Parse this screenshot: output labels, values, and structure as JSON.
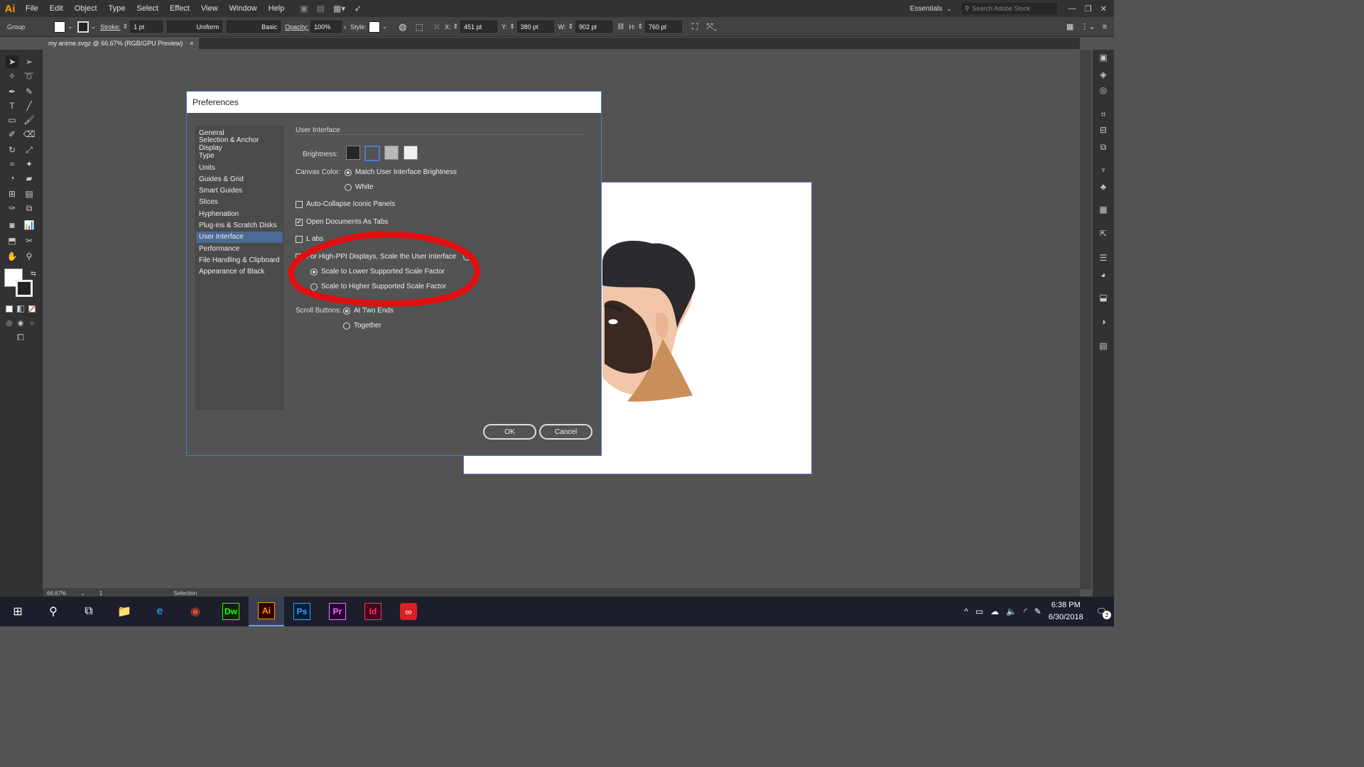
{
  "menubar": {
    "logo": "Ai",
    "items": [
      "File",
      "Edit",
      "Object",
      "Type",
      "Select",
      "Effect",
      "View",
      "Window",
      "Help"
    ],
    "workspace": "Essentials",
    "search_placeholder": "Search Adobe Stock"
  },
  "control_bar": {
    "selection": "Group",
    "stroke_label": "Stroke:",
    "stroke_value": "1 pt",
    "profile": "Uniform",
    "brush": "Basic",
    "opacity_label": "Opacity:",
    "opacity_value": "100%",
    "style_label": "Style:",
    "x_label": "X:",
    "x_value": "451 pt",
    "y_label": "Y:",
    "y_value": "380 pt",
    "w_label": "W:",
    "w_value": "902 pt",
    "h_label": "H:",
    "h_value": "760 pt"
  },
  "document_tab": {
    "title": "my anime.svgz @ 66.67% (RGB/GPU Preview)",
    "close": "×"
  },
  "status_bar": {
    "zoom": "66.67%",
    "page": "1",
    "tool": "Selection"
  },
  "dialog": {
    "title": "Preferences",
    "categories": [
      "General",
      "Selection & Anchor Display",
      "Type",
      "Units",
      "Guides & Grid",
      "Smart Guides",
      "Slices",
      "Hyphenation",
      "Plug-ins & Scratch Disks",
      "User Interface",
      "Performance",
      "File Handling & Clipboard",
      "Appearance of Black"
    ],
    "selected_category": "User Interface",
    "section_title": "User Interface",
    "brightness_label": "Brightness:",
    "brightness_swatches": [
      "#262626",
      "#535353",
      "#b8b8b8",
      "#f0f0f0"
    ],
    "canvas_color_label": "Canvas Color:",
    "canvas_match": "Match User Interface Brightness",
    "canvas_white": "White",
    "auto_collapse": "Auto-Collapse Iconic Panels",
    "open_as_tabs": "Open Documents As Tabs",
    "hidden_option": "L           abs",
    "high_ppi": "For High-PPI Displays, Scale the User Interface",
    "scale_lower": "Scale to Lower Supported Scale Factor",
    "scale_higher": "Scale to Higher Supported Scale Factor",
    "scroll_label": "Scroll Buttons:",
    "scroll_ends": "At Two Ends",
    "scroll_together": "Together",
    "ok": "OK",
    "cancel": "Cancel"
  },
  "taskbar": {
    "apps": [
      {
        "name": "Dw",
        "color": "#35fa00",
        "bg": "#072401"
      },
      {
        "name": "Ai",
        "color": "#ff9a00",
        "bg": "#330000"
      },
      {
        "name": "Ps",
        "color": "#31a8ff",
        "bg": "#001e36"
      },
      {
        "name": "Pr",
        "color": "#ea77ff",
        "bg": "#2a0034"
      },
      {
        "name": "Id",
        "color": "#ff3366",
        "bg": "#49021f"
      }
    ],
    "time": "6:38 PM",
    "date": "6/30/2018",
    "notification_count": "2"
  },
  "accent_colors": {
    "highlight_circle": "#e01010",
    "selection": "#4b6a94"
  }
}
